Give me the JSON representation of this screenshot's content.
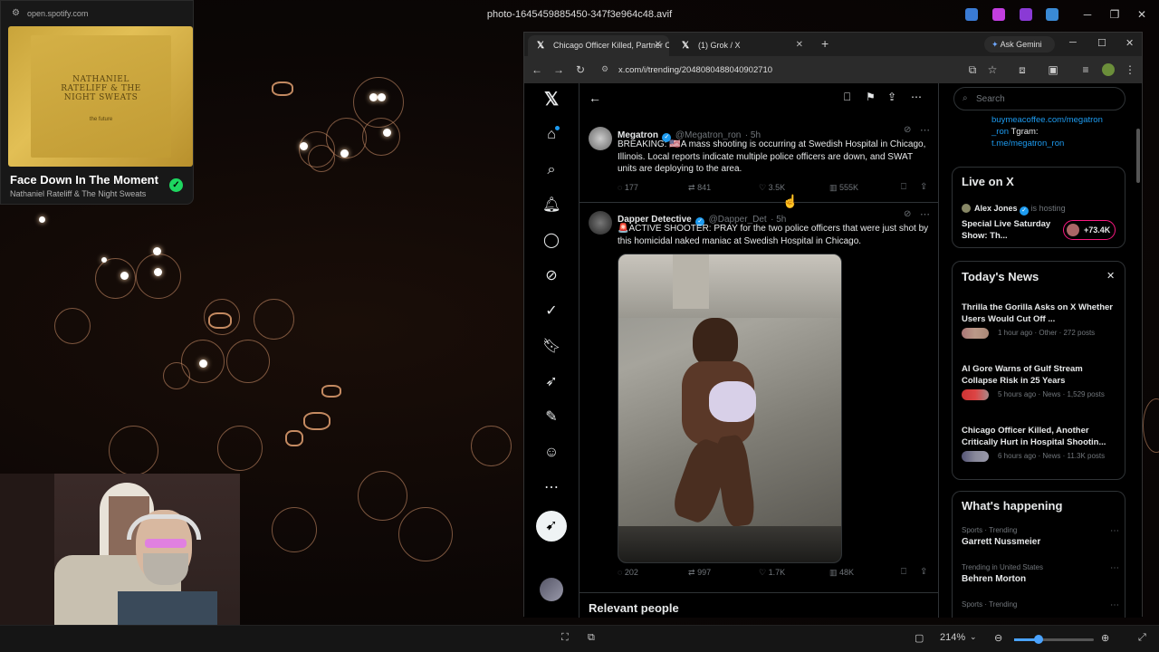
{
  "viewer": {
    "filename": "photo-1645459885450-347f3e964c48.avif",
    "zoom": "214%"
  },
  "spotify": {
    "url": "open.spotify.com",
    "album_art_text": "NATHANIEL RATELIFF & THE NIGHT SWEATS",
    "album_art_sub": "the future",
    "song_title": "Face Down In The Moment",
    "artist": "Nathaniel Rateliff & The Night Sweats"
  },
  "browser": {
    "tabs": [
      {
        "label": "Chicago Officer Killed, Partner C",
        "active": true
      },
      {
        "label": "(1) Grok / X",
        "active": false
      }
    ],
    "new_tab": "+",
    "ask_gemini": "Ask Gemini",
    "url": "x.com/i/trending/2048080488040902710"
  },
  "tweets": [
    {
      "name": "Megatron",
      "handle": "@Megatron_ron",
      "time": "· 5h",
      "text": "BREAKING: 🇺🇸A mass shooting is occurring at Swedish Hospital in Chicago, Illinois. Local reports indicate multiple police officers are down, and SWAT units are deploying to the area.",
      "replies": "177",
      "reposts": "841",
      "likes": "3.5K",
      "views": "555K"
    },
    {
      "name": "Dapper Detective",
      "handle": "@Dapper_Det",
      "time": "· 5h",
      "text": "🚨ACTIVE SHOOTER: PRAY for the two police officers that were just shot by this homicidal naked maniac at Swedish Hospital in Chicago.",
      "replies": "202",
      "reposts": "997",
      "likes": "1.7K",
      "views": "48K"
    }
  ],
  "relevant_people": "Relevant people",
  "sidebar": {
    "search_placeholder": "Search",
    "bio_link1": "buymeacoffee.com/megatron",
    "bio_link2": "_ron",
    "bio_tgram": "Tgram:",
    "bio_link3": "t.me/megatron_ron",
    "live_title": "Live on X",
    "live_host": "Alex Jones",
    "live_hosting": "is hosting",
    "live_show": "Special Live Saturday Show: Th...",
    "live_count": "+73.4K",
    "news_title": "Today's News",
    "news": [
      {
        "title": "Thrilla the Gorilla Asks on X Whether Users Would Cut Off ...",
        "meta": "1 hour ago · Other · 272 posts"
      },
      {
        "title": "Al Gore Warns of Gulf Stream Collapse Risk in 25 Years",
        "meta": "5 hours ago · News · 1,529 posts"
      },
      {
        "title": "Chicago Officer Killed, Another Critically Hurt in Hospital Shootin...",
        "meta": "6 hours ago · News · 11.3K posts"
      }
    ],
    "happening_title": "What's happening",
    "trends": [
      {
        "context": "Sports · Trending",
        "name": "Garrett Nussmeier"
      },
      {
        "context": "Trending in United States",
        "name": "Behren Morton"
      },
      {
        "context": "Sports · Trending",
        "name": ""
      }
    ]
  },
  "colors": {
    "x_blue": "#1d9bf0",
    "spotify_green": "#1ed760",
    "live_pink": "#f91880"
  }
}
